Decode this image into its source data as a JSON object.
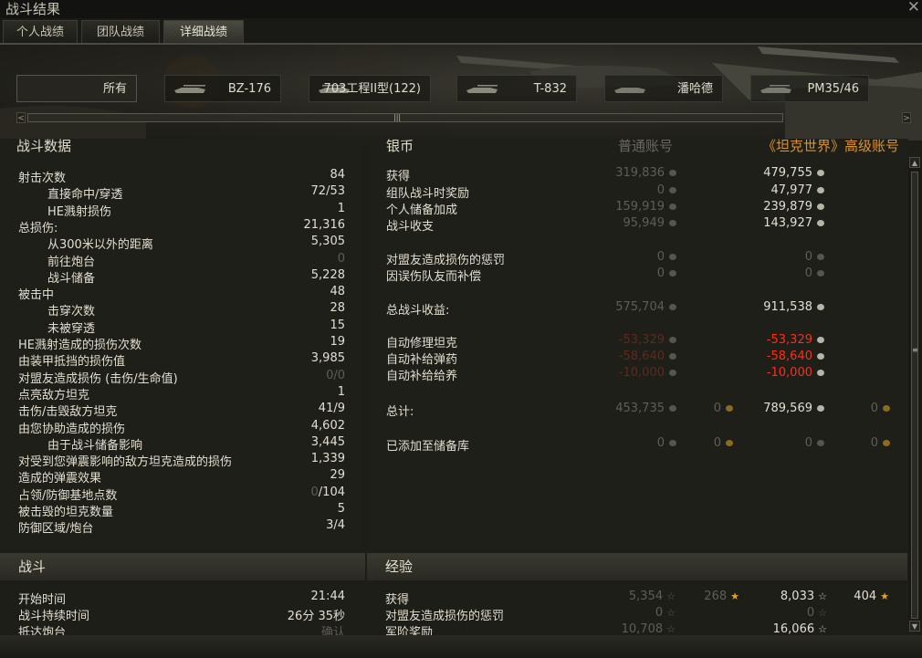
{
  "window": {
    "title": "战斗结果",
    "close": "✕"
  },
  "tabs": [
    {
      "label": "个人战绩"
    },
    {
      "label": "团队战绩"
    },
    {
      "label": "详细战绩"
    }
  ],
  "vehicle_tabs": [
    {
      "label": "所有"
    },
    {
      "label": "BZ-176"
    },
    {
      "label": "703工程II型(122)"
    },
    {
      "label": "T-832"
    },
    {
      "label": "潘哈德"
    },
    {
      "label": "PM35/46"
    }
  ],
  "battle_data": {
    "header": "战斗数据",
    "rows": [
      {
        "label": "射击次数",
        "value": "84"
      },
      {
        "label": "直接命中/穿透",
        "value": "72/53"
      },
      {
        "label": "HE溅射损伤",
        "value": "1"
      },
      {
        "label": "总损伤:",
        "value": "21,316"
      },
      {
        "label": "从300米以外的距离",
        "value": "5,305"
      },
      {
        "label": "前往炮台",
        "value": "0"
      },
      {
        "label": "战斗储备",
        "value": "5,228"
      },
      {
        "label": "被击中",
        "value": "48"
      },
      {
        "label": "击穿次数",
        "value": "28"
      },
      {
        "label": "未被穿透",
        "value": "15"
      },
      {
        "label": "HE溅射造成的损伤次数",
        "value": "19"
      },
      {
        "label": "由装甲抵挡的损伤值",
        "value": "3,985"
      },
      {
        "label": "对盟友造成损伤 (击伤/生命值)",
        "value": "0/0"
      },
      {
        "label": "点亮敌方坦克",
        "value": "1"
      },
      {
        "label": "击伤/击毁敌方坦克",
        "value": "41/9"
      },
      {
        "label": "由您协助造成的损伤",
        "value": "4,602"
      },
      {
        "label": "由于战斗储备影响",
        "value": "3,445"
      },
      {
        "label": "对受到您弹震影响的敌方坦克造成的损伤",
        "value": "1,339"
      },
      {
        "label": "造成的弹震效果",
        "value": "29"
      },
      {
        "label": "占领/防御基地点数",
        "value_dim": "0",
        "value": "/104"
      },
      {
        "label": "被击毁的坦克数量",
        "value": "5"
      },
      {
        "label": "防御区域/炮台",
        "value": "3/4"
      }
    ]
  },
  "credits": {
    "header_left": "银币",
    "header_mid": "普通账号",
    "header_right": "《坦克世界》高级账号",
    "rows": [
      {
        "label": "获得",
        "std": "319,836",
        "prem": "479,755"
      },
      {
        "label": "组队战斗时奖励",
        "std": "0",
        "prem": "47,977"
      },
      {
        "label": "个人储备加成",
        "std": "159,919",
        "prem": "239,879"
      },
      {
        "label": "战斗收支",
        "std": "95,949",
        "prem": "143,927"
      },
      {
        "label": "对盟友造成损伤的惩罚",
        "std": "0",
        "prem": "0"
      },
      {
        "label": "因误伤队友而补偿",
        "std": "0",
        "prem": "0"
      },
      {
        "label": "总战斗收益:",
        "std": "575,704",
        "prem": "911,538"
      },
      {
        "label": "自动修理坦克",
        "std": "-53,329",
        "prem": "-53,329"
      },
      {
        "label": "自动补给弹药",
        "std": "-58,640",
        "prem": "-58,640"
      },
      {
        "label": "自动补给给养",
        "std": "-10,000",
        "prem": "-10,000"
      },
      {
        "label": "总计:",
        "std": "453,735",
        "std_gold": "0",
        "prem": "789,569",
        "prem_gold": "0"
      },
      {
        "label": "已添加至储备库",
        "std": "0",
        "std_gold": "0",
        "prem": "0",
        "prem_gold": "0"
      }
    ]
  },
  "battle": {
    "header": "战斗",
    "rows": [
      {
        "label": "开始时间",
        "value": "21:44"
      },
      {
        "label": "战斗持续时间",
        "value": "26分 35秒"
      },
      {
        "label": "抵达炮台",
        "value": "确认"
      }
    ]
  },
  "experience": {
    "header": "经验",
    "rows": [
      {
        "label": "获得",
        "std": "5,354",
        "std_free": "268",
        "prem": "8,033",
        "prem_free": "404"
      },
      {
        "label": "对盟友造成损伤的惩罚",
        "std": "0",
        "prem": "0"
      },
      {
        "label": "军阶奖励",
        "std": "10,708",
        "prem": "16,066"
      }
    ]
  },
  "scroll": {
    "grip": "|||",
    "up": "▲",
    "down": "▼",
    "left": "<",
    "right": ">"
  }
}
